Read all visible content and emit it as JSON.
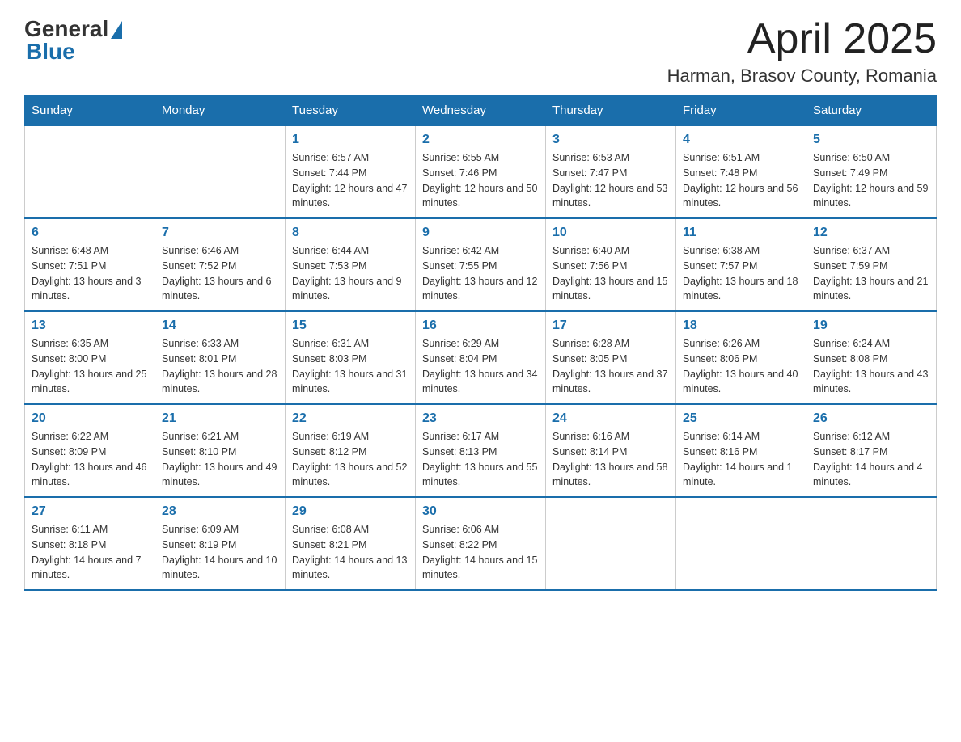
{
  "header": {
    "logo": {
      "text_general": "General",
      "text_blue": "Blue"
    },
    "title": "April 2025",
    "location": "Harman, Brasov County, Romania"
  },
  "weekdays": [
    "Sunday",
    "Monday",
    "Tuesday",
    "Wednesday",
    "Thursday",
    "Friday",
    "Saturday"
  ],
  "weeks": [
    [
      {
        "day": "",
        "sunrise": "",
        "sunset": "",
        "daylight": ""
      },
      {
        "day": "",
        "sunrise": "",
        "sunset": "",
        "daylight": ""
      },
      {
        "day": "1",
        "sunrise": "Sunrise: 6:57 AM",
        "sunset": "Sunset: 7:44 PM",
        "daylight": "Daylight: 12 hours and 47 minutes."
      },
      {
        "day": "2",
        "sunrise": "Sunrise: 6:55 AM",
        "sunset": "Sunset: 7:46 PM",
        "daylight": "Daylight: 12 hours and 50 minutes."
      },
      {
        "day": "3",
        "sunrise": "Sunrise: 6:53 AM",
        "sunset": "Sunset: 7:47 PM",
        "daylight": "Daylight: 12 hours and 53 minutes."
      },
      {
        "day": "4",
        "sunrise": "Sunrise: 6:51 AM",
        "sunset": "Sunset: 7:48 PM",
        "daylight": "Daylight: 12 hours and 56 minutes."
      },
      {
        "day": "5",
        "sunrise": "Sunrise: 6:50 AM",
        "sunset": "Sunset: 7:49 PM",
        "daylight": "Daylight: 12 hours and 59 minutes."
      }
    ],
    [
      {
        "day": "6",
        "sunrise": "Sunrise: 6:48 AM",
        "sunset": "Sunset: 7:51 PM",
        "daylight": "Daylight: 13 hours and 3 minutes."
      },
      {
        "day": "7",
        "sunrise": "Sunrise: 6:46 AM",
        "sunset": "Sunset: 7:52 PM",
        "daylight": "Daylight: 13 hours and 6 minutes."
      },
      {
        "day": "8",
        "sunrise": "Sunrise: 6:44 AM",
        "sunset": "Sunset: 7:53 PM",
        "daylight": "Daylight: 13 hours and 9 minutes."
      },
      {
        "day": "9",
        "sunrise": "Sunrise: 6:42 AM",
        "sunset": "Sunset: 7:55 PM",
        "daylight": "Daylight: 13 hours and 12 minutes."
      },
      {
        "day": "10",
        "sunrise": "Sunrise: 6:40 AM",
        "sunset": "Sunset: 7:56 PM",
        "daylight": "Daylight: 13 hours and 15 minutes."
      },
      {
        "day": "11",
        "sunrise": "Sunrise: 6:38 AM",
        "sunset": "Sunset: 7:57 PM",
        "daylight": "Daylight: 13 hours and 18 minutes."
      },
      {
        "day": "12",
        "sunrise": "Sunrise: 6:37 AM",
        "sunset": "Sunset: 7:59 PM",
        "daylight": "Daylight: 13 hours and 21 minutes."
      }
    ],
    [
      {
        "day": "13",
        "sunrise": "Sunrise: 6:35 AM",
        "sunset": "Sunset: 8:00 PM",
        "daylight": "Daylight: 13 hours and 25 minutes."
      },
      {
        "day": "14",
        "sunrise": "Sunrise: 6:33 AM",
        "sunset": "Sunset: 8:01 PM",
        "daylight": "Daylight: 13 hours and 28 minutes."
      },
      {
        "day": "15",
        "sunrise": "Sunrise: 6:31 AM",
        "sunset": "Sunset: 8:03 PM",
        "daylight": "Daylight: 13 hours and 31 minutes."
      },
      {
        "day": "16",
        "sunrise": "Sunrise: 6:29 AM",
        "sunset": "Sunset: 8:04 PM",
        "daylight": "Daylight: 13 hours and 34 minutes."
      },
      {
        "day": "17",
        "sunrise": "Sunrise: 6:28 AM",
        "sunset": "Sunset: 8:05 PM",
        "daylight": "Daylight: 13 hours and 37 minutes."
      },
      {
        "day": "18",
        "sunrise": "Sunrise: 6:26 AM",
        "sunset": "Sunset: 8:06 PM",
        "daylight": "Daylight: 13 hours and 40 minutes."
      },
      {
        "day": "19",
        "sunrise": "Sunrise: 6:24 AM",
        "sunset": "Sunset: 8:08 PM",
        "daylight": "Daylight: 13 hours and 43 minutes."
      }
    ],
    [
      {
        "day": "20",
        "sunrise": "Sunrise: 6:22 AM",
        "sunset": "Sunset: 8:09 PM",
        "daylight": "Daylight: 13 hours and 46 minutes."
      },
      {
        "day": "21",
        "sunrise": "Sunrise: 6:21 AM",
        "sunset": "Sunset: 8:10 PM",
        "daylight": "Daylight: 13 hours and 49 minutes."
      },
      {
        "day": "22",
        "sunrise": "Sunrise: 6:19 AM",
        "sunset": "Sunset: 8:12 PM",
        "daylight": "Daylight: 13 hours and 52 minutes."
      },
      {
        "day": "23",
        "sunrise": "Sunrise: 6:17 AM",
        "sunset": "Sunset: 8:13 PM",
        "daylight": "Daylight: 13 hours and 55 minutes."
      },
      {
        "day": "24",
        "sunrise": "Sunrise: 6:16 AM",
        "sunset": "Sunset: 8:14 PM",
        "daylight": "Daylight: 13 hours and 58 minutes."
      },
      {
        "day": "25",
        "sunrise": "Sunrise: 6:14 AM",
        "sunset": "Sunset: 8:16 PM",
        "daylight": "Daylight: 14 hours and 1 minute."
      },
      {
        "day": "26",
        "sunrise": "Sunrise: 6:12 AM",
        "sunset": "Sunset: 8:17 PM",
        "daylight": "Daylight: 14 hours and 4 minutes."
      }
    ],
    [
      {
        "day": "27",
        "sunrise": "Sunrise: 6:11 AM",
        "sunset": "Sunset: 8:18 PM",
        "daylight": "Daylight: 14 hours and 7 minutes."
      },
      {
        "day": "28",
        "sunrise": "Sunrise: 6:09 AM",
        "sunset": "Sunset: 8:19 PM",
        "daylight": "Daylight: 14 hours and 10 minutes."
      },
      {
        "day": "29",
        "sunrise": "Sunrise: 6:08 AM",
        "sunset": "Sunset: 8:21 PM",
        "daylight": "Daylight: 14 hours and 13 minutes."
      },
      {
        "day": "30",
        "sunrise": "Sunrise: 6:06 AM",
        "sunset": "Sunset: 8:22 PM",
        "daylight": "Daylight: 14 hours and 15 minutes."
      },
      {
        "day": "",
        "sunrise": "",
        "sunset": "",
        "daylight": ""
      },
      {
        "day": "",
        "sunrise": "",
        "sunset": "",
        "daylight": ""
      },
      {
        "day": "",
        "sunrise": "",
        "sunset": "",
        "daylight": ""
      }
    ]
  ]
}
